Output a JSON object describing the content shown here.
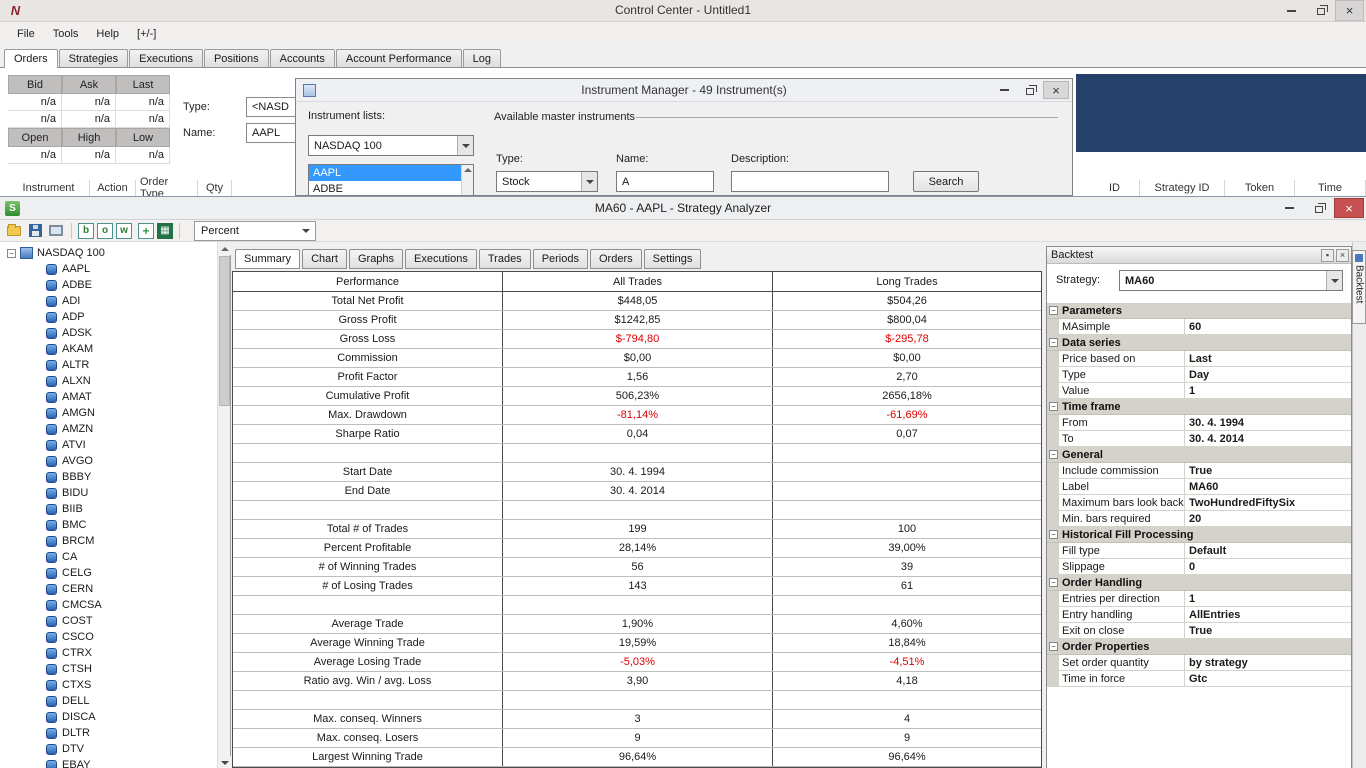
{
  "icons": {
    "close": "×",
    "collapse": "−",
    "excel": "▦"
  },
  "colors": {
    "selection_blue": "#3399ff",
    "negative_red": "#e00000",
    "close_button_red": "#c75050",
    "dark_panel_navy": "#24406b"
  },
  "control_center": {
    "title": "Control Center - Untitled1",
    "menu": [
      "File",
      "Tools",
      "Help",
      "[+/-]"
    ],
    "tabs": [
      "Orders",
      "Strategies",
      "Executions",
      "Positions",
      "Accounts",
      "Account Performance",
      "Log"
    ],
    "active_tab": "Orders",
    "market_grid": {
      "header1": [
        "Bid",
        "Ask",
        "Last"
      ],
      "rows1": [
        [
          "n/a",
          "n/a",
          "n/a"
        ],
        [
          "n/a",
          "n/a",
          "n/a"
        ]
      ],
      "header2": [
        "Open",
        "High",
        "Low"
      ],
      "rows2": [
        [
          "n/a",
          "n/a",
          "n/a"
        ]
      ]
    },
    "order_entry": {
      "type_label": "Type:",
      "type_value": "<NASD",
      "name_label": "Name:",
      "name_value": "AAPL"
    },
    "orders_columns_left": [
      "Instrument",
      "Action",
      "Order Type",
      "Qty"
    ],
    "orders_columns_right": [
      "ID",
      "Strategy ID",
      "Token",
      "Time"
    ]
  },
  "instrument_manager": {
    "title": "Instrument Manager - 49 Instrument(s)",
    "lists_label": "Instrument lists:",
    "list_value": "NASDAQ 100",
    "list_items": [
      "AAPL",
      "ADBE"
    ],
    "selected_item": "AAPL",
    "group_label": "Available master instruments",
    "type_label": "Type:",
    "type_value": "Stock",
    "name_label": "Name:",
    "name_value": "A",
    "description_label": "Description:",
    "description_value": "",
    "search_button": "Search"
  },
  "strategy_analyzer": {
    "title": "MA60 - AAPL - Strategy Analyzer",
    "toolbar": {
      "display_mode": "Percent",
      "letter_buttons": [
        "b",
        "o",
        "w"
      ]
    },
    "tree": {
      "root": "NASDAQ 100",
      "items": [
        "AAPL",
        "ADBE",
        "ADI",
        "ADP",
        "ADSK",
        "AKAM",
        "ALTR",
        "ALXN",
        "AMAT",
        "AMGN",
        "AMZN",
        "ATVI",
        "AVGO",
        "BBBY",
        "BIDU",
        "BIIB",
        "BMC",
        "BRCM",
        "CA",
        "CELG",
        "CERN",
        "CMCSA",
        "COST",
        "CSCO",
        "CTRX",
        "CTSH",
        "CTXS",
        "DELL",
        "DISCA",
        "DLTR",
        "DTV",
        "EBAY"
      ]
    },
    "tabs": [
      "Summary",
      "Chart",
      "Graphs",
      "Executions",
      "Trades",
      "Periods",
      "Orders",
      "Settings"
    ],
    "active_tab": "Summary",
    "summary_table": {
      "columns": [
        "Performance",
        "All Trades",
        "Long Trades"
      ],
      "rows": [
        {
          "label": "Total Net Profit",
          "all": "$448,05",
          "long": "$504,26"
        },
        {
          "label": "Gross Profit",
          "all": "$1242,85",
          "long": "$800,04"
        },
        {
          "label": "Gross Loss",
          "all": "$-794,80",
          "long": "$-295,78",
          "neg": true
        },
        {
          "label": "Commission",
          "all": "$0,00",
          "long": "$0,00"
        },
        {
          "label": "Profit Factor",
          "all": "1,56",
          "long": "2,70"
        },
        {
          "label": "Cumulative Profit",
          "all": "506,23%",
          "long": "2656,18%"
        },
        {
          "label": "Max. Drawdown",
          "all": "-81,14%",
          "long": "-61,69%",
          "neg": true
        },
        {
          "label": "Sharpe Ratio",
          "all": "0,04",
          "long": "0,07"
        },
        {
          "blank": true
        },
        {
          "label": "Start Date",
          "all": "30. 4. 1994",
          "long": ""
        },
        {
          "label": "End Date",
          "all": "30. 4. 2014",
          "long": ""
        },
        {
          "blank": true
        },
        {
          "label": "Total # of Trades",
          "all": "199",
          "long": "100"
        },
        {
          "label": "Percent Profitable",
          "all": "28,14%",
          "long": "39,00%"
        },
        {
          "label": "# of Winning Trades",
          "all": "56",
          "long": "39"
        },
        {
          "label": "# of Losing Trades",
          "all": "143",
          "long": "61"
        },
        {
          "blank": true
        },
        {
          "label": "Average Trade",
          "all": "1,90%",
          "long": "4,60%"
        },
        {
          "label": "Average Winning Trade",
          "all": "19,59%",
          "long": "18,84%"
        },
        {
          "label": "Average Losing Trade",
          "all": "-5,03%",
          "long": "-4,51%",
          "neg": true
        },
        {
          "label": "Ratio avg. Win / avg. Loss",
          "all": "3,90",
          "long": "4,18"
        },
        {
          "blank": true
        },
        {
          "label": "Max. conseq. Winners",
          "all": "3",
          "long": "4"
        },
        {
          "label": "Max. conseq. Losers",
          "all": "9",
          "long": "9"
        },
        {
          "label": "Largest Winning Trade",
          "all": "96,64%",
          "long": "96,64%"
        }
      ]
    },
    "backtest_panel": {
      "title": "Backtest",
      "strategy_label": "Strategy:",
      "strategy_value": "MA60",
      "properties": [
        {
          "cat": "Parameters"
        },
        {
          "name": "MAsimple",
          "value": "60"
        },
        {
          "cat": "Data series"
        },
        {
          "name": "Price based on",
          "value": "Last"
        },
        {
          "name": "Type",
          "value": "Day"
        },
        {
          "name": "Value",
          "value": "1"
        },
        {
          "cat": "Time frame"
        },
        {
          "name": "From",
          "value": "30. 4. 1994"
        },
        {
          "name": "To",
          "value": "30. 4. 2014"
        },
        {
          "cat": "General"
        },
        {
          "name": "Include commission",
          "value": "True"
        },
        {
          "name": "Label",
          "value": "MA60"
        },
        {
          "name": "Maximum bars look back",
          "value": "TwoHundredFiftySix"
        },
        {
          "name": "Min. bars required",
          "value": "20"
        },
        {
          "cat": "Historical Fill Processing"
        },
        {
          "name": "Fill type",
          "value": "Default"
        },
        {
          "name": "Slippage",
          "value": "0"
        },
        {
          "cat": "Order Handling"
        },
        {
          "name": "Entries per direction",
          "value": "1"
        },
        {
          "name": "Entry handling",
          "value": "AllEntries"
        },
        {
          "name": "Exit on close",
          "value": "True"
        },
        {
          "cat": "Order Properties"
        },
        {
          "name": "Set order quantity",
          "value": "by strategy"
        },
        {
          "name": "Time in force",
          "value": "Gtc"
        }
      ]
    },
    "side_tab": "Backtest"
  }
}
